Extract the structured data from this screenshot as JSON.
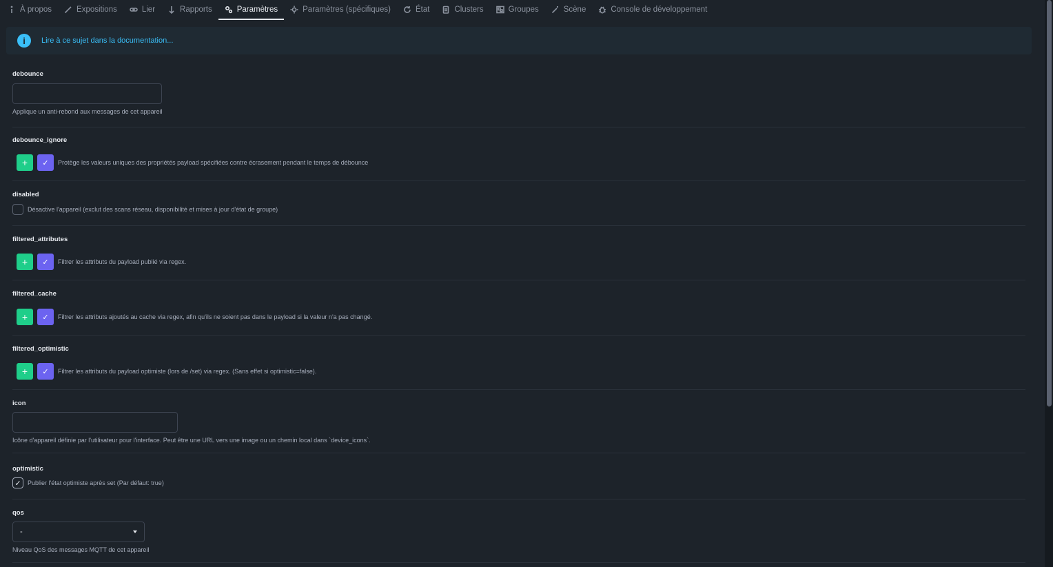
{
  "tabs": [
    {
      "label": "À propos",
      "icon": "info-icon"
    },
    {
      "label": "Expositions",
      "icon": "pencil-icon"
    },
    {
      "label": "Lier",
      "icon": "link-icon"
    },
    {
      "label": "Rapports",
      "icon": "arrow-down-icon"
    },
    {
      "label": "Paramètres",
      "icon": "gears-icon",
      "active": true
    },
    {
      "label": "Paramètres (spécifiques)",
      "icon": "gear-icon"
    },
    {
      "label": "État",
      "icon": "refresh-icon"
    },
    {
      "label": "Clusters",
      "icon": "clipboard-icon"
    },
    {
      "label": "Groupes",
      "icon": "object-group-icon"
    },
    {
      "label": "Scène",
      "icon": "magic-wand-icon"
    },
    {
      "label": "Console de développement",
      "icon": "bug-icon"
    }
  ],
  "alert": {
    "link_text": "Lire à ce sujet dans la documentation..."
  },
  "fields": {
    "debounce": {
      "label": "debounce",
      "value": "",
      "description": "Applique un anti-rebond aux messages de cet appareil"
    },
    "debounce_ignore": {
      "label": "debounce_ignore",
      "add": "+",
      "apply": "✓",
      "description": "Protège les valeurs uniques des propriétés payload spécifiées contre écrasement pendant le temps de débounce"
    },
    "disabled": {
      "label": "disabled",
      "checked": false,
      "description": "Désactive l'appareil (exclut des scans réseau, disponibilité et mises à jour d'état de groupe)"
    },
    "filtered_attributes": {
      "label": "filtered_attributes",
      "add": "+",
      "apply": "✓",
      "description": "Filtrer les attributs du payload publié via regex."
    },
    "filtered_cache": {
      "label": "filtered_cache",
      "add": "+",
      "apply": "✓",
      "description": "Filtrer les attributs ajoutés au cache via regex, afin qu'ils ne soient pas dans le payload si la valeur n'a pas changé."
    },
    "filtered_optimistic": {
      "label": "filtered_optimistic",
      "add": "+",
      "apply": "✓",
      "description": "Filtrer les attributs du payload optimiste (lors de /set) via regex. (Sans effet si optimistic=false)."
    },
    "icon": {
      "label": "icon",
      "value": "",
      "description": "Icône d'appareil définie par l'utilisateur pour l'interface. Peut être une URL vers une image ou un chemin local dans `device_icons`."
    },
    "optimistic": {
      "label": "optimistic",
      "checked": true,
      "check_glyph": "✓",
      "description": "Publier l'état optimiste après set (Par défaut: true)"
    },
    "qos": {
      "label": "qos",
      "selected": "-",
      "description": "Niveau QoS des messages MQTT de cet appareil"
    }
  },
  "colors": {
    "accent": "#3abff8",
    "add_button": "#1fce8a",
    "apply_button": "#6c63f0",
    "background": "#1d232a"
  }
}
